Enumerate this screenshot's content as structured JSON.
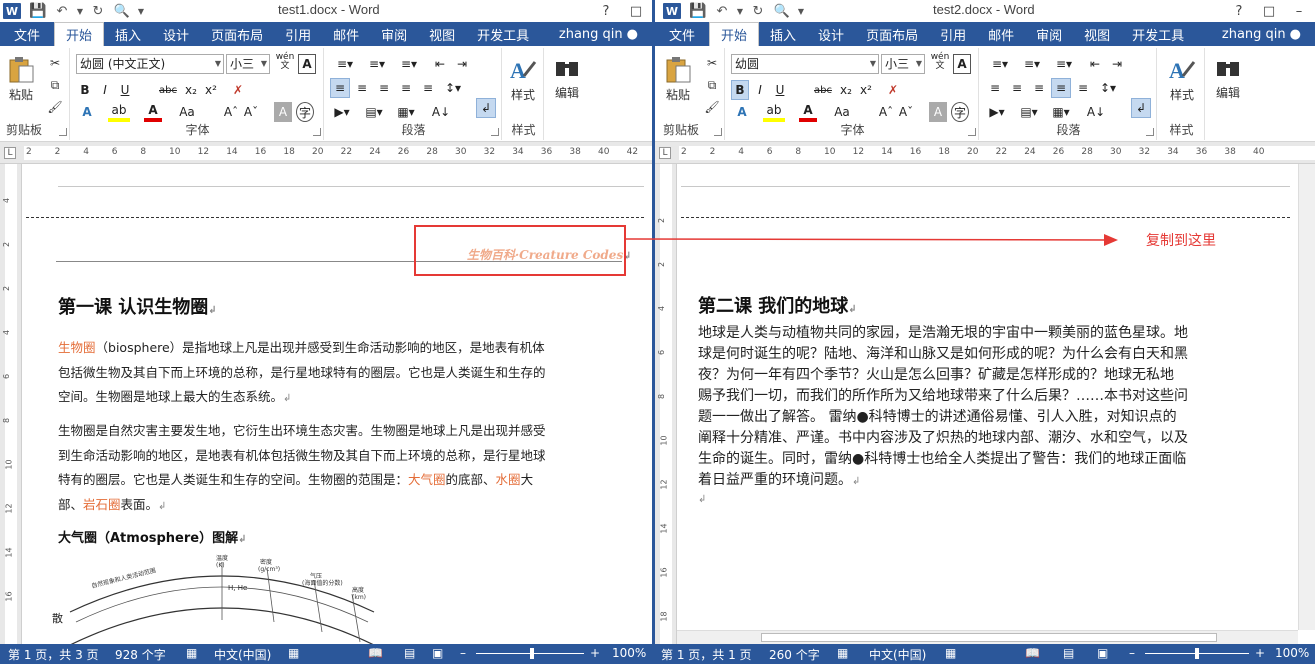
{
  "left": {
    "title": "test1.docx - Word",
    "tabs": [
      "文件",
      "开始",
      "插入",
      "设计",
      "页面布局",
      "引用",
      "邮件",
      "审阅",
      "视图",
      "开发工具"
    ],
    "user": "zhang qin",
    "ribbon": {
      "paste": "粘贴",
      "clipboard": "剪贴板",
      "font_name": "幼圆 (中文正文)",
      "font_size": "小三",
      "font_group": "字体",
      "para_group": "段落",
      "styles_label": "样式",
      "styles_group": "样式",
      "wen": "wén",
      "bold": "B",
      "italic": "I",
      "underline": "U",
      "strike": "abc",
      "sub": "x₂",
      "sup": "x²"
    },
    "ruler_ticks": [
      "2",
      "2",
      "4",
      "6",
      "8",
      "10",
      "12",
      "14",
      "16",
      "18",
      "20",
      "22",
      "24",
      "26",
      "28",
      "30",
      "32",
      "34",
      "36",
      "38",
      "40",
      "42"
    ],
    "vruler_ticks": [
      "4",
      "2",
      "2",
      "4",
      "6",
      "8",
      "10",
      "12",
      "14",
      "16"
    ],
    "header_text": "生物百科·Creature Codes",
    "heading": "第一课 认识生物圈",
    "para1": {
      "term": "生物圈",
      "rest_line1": "（biosphere）是指地球上凡是出现并感受到生命活动影响的地区，是地表有机体",
      "line2": "包括微生物及其自下而上环境的总称，是行星地球特有的圈层。它也是人类诞生和生存的",
      "line3": "空间。生物圈是地球上最大的生态系统。"
    },
    "para2": {
      "line1": "生物圈是自然灾害主要发生地，它衍生出环境生态灾害。生物圈是地球上凡是出现并感受",
      "line2": "到生命活动影响的地区，是地表有机体包括微生物及其自下而上环境的总称，是行星地球",
      "line3_a": "特有的圈层。它也是人类诞生和生存的空间。生物圈的范围是：",
      "atmo": "大气圈",
      "line3_b": "的底部、",
      "hydro": "水圈",
      "line3_c": "大",
      "line4_a": "部、",
      "litho": "岩石圈",
      "line4_b": "表面。"
    },
    "subheading": "大气圈（Atmosphere）图解",
    "figure_labels": {
      "arc_title": "自然现象和人类活动范围",
      "temp": "温度",
      "temp_unit": "(K)",
      "density": "密度",
      "density_unit": "(g/cm³)",
      "pressure": "气压",
      "pressure_unit": "(海面值的分数)",
      "altitude": "高度",
      "altitude_unit": "(km)",
      "gas": "H, He",
      "left_char": "散"
    },
    "status": {
      "pages": "第 1 页，共 3 页",
      "words": "928 个字",
      "lang": "中文(中国)",
      "zoom": "100%"
    }
  },
  "right": {
    "title": "test2.docx - Word",
    "tabs": [
      "文件",
      "开始",
      "插入",
      "设计",
      "页面布局",
      "引用",
      "邮件",
      "审阅",
      "视图",
      "开发工具"
    ],
    "user": "zhang qin",
    "ribbon": {
      "paste": "粘贴",
      "clipboard": "剪贴板",
      "font_name": "幼圆",
      "font_size": "小三",
      "font_group": "字体",
      "para_group": "段落",
      "styles_label": "样式",
      "styles_group": "样式",
      "edit_label": "编辑",
      "wen": "wén",
      "bold": "B",
      "italic": "I",
      "underline": "U",
      "strike": "abc",
      "sub": "x₂",
      "sup": "x²"
    },
    "ruler_ticks": [
      "2",
      "2",
      "4",
      "6",
      "8",
      "10",
      "12",
      "14",
      "16",
      "18",
      "20",
      "22",
      "24",
      "26",
      "28",
      "30",
      "32",
      "34",
      "36",
      "38",
      "40"
    ],
    "vruler_ticks": [
      "2",
      "2",
      "4",
      "6",
      "8",
      "10",
      "12",
      "14",
      "16",
      "18"
    ],
    "heading": "第二课 我们的地球",
    "body_lines": [
      "地球是人类与动植物共同的家园，是浩瀚无垠的宇宙中一颗美丽的蓝色星球。地",
      "球是何时诞生的呢？陆地、海洋和山脉又是如何形成的呢？为什么会有白天和黑",
      "夜？为何一年有四个季节？火山是怎么回事？矿藏是怎样形成的？地球无私地",
      "赐予我们一切，而我们的所作所为又给地球带来了什么后果？……本书对这些问",
      "题一一做出了解答。 雷纳●科特博士的讲述通俗易懂、引人入胜，对知识点的",
      "阐释十分精准、严谨。书中内容涉及了炽热的地球内部、潮汐、水和空气，以及",
      "生命的诞生。同时，雷纳●科特博士也给全人类提出了警告：我们的地球正面临",
      "着日益严重的环境问题。"
    ],
    "status": {
      "pages": "第 1 页，共 1 页",
      "words": "260 个字",
      "lang": "中文(中国)",
      "zoom": "100%"
    }
  },
  "annotation": "复制到这里",
  "colors": {
    "word_blue": "#2b579a",
    "accent_orange": "#e46d38",
    "annotation_red": "#e53935"
  }
}
